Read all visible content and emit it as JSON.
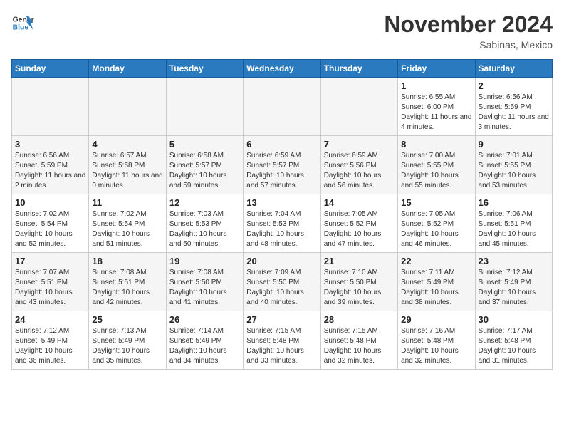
{
  "header": {
    "logo_line1": "General",
    "logo_line2": "Blue",
    "month": "November 2024",
    "location": "Sabinas, Mexico"
  },
  "weekdays": [
    "Sunday",
    "Monday",
    "Tuesday",
    "Wednesday",
    "Thursday",
    "Friday",
    "Saturday"
  ],
  "weeks": [
    [
      {
        "day": "",
        "info": ""
      },
      {
        "day": "",
        "info": ""
      },
      {
        "day": "",
        "info": ""
      },
      {
        "day": "",
        "info": ""
      },
      {
        "day": "",
        "info": ""
      },
      {
        "day": "1",
        "info": "Sunrise: 6:55 AM\nSunset: 6:00 PM\nDaylight: 11 hours and 4 minutes."
      },
      {
        "day": "2",
        "info": "Sunrise: 6:56 AM\nSunset: 5:59 PM\nDaylight: 11 hours and 3 minutes."
      }
    ],
    [
      {
        "day": "3",
        "info": "Sunrise: 6:56 AM\nSunset: 5:59 PM\nDaylight: 11 hours and 2 minutes."
      },
      {
        "day": "4",
        "info": "Sunrise: 6:57 AM\nSunset: 5:58 PM\nDaylight: 11 hours and 0 minutes."
      },
      {
        "day": "5",
        "info": "Sunrise: 6:58 AM\nSunset: 5:57 PM\nDaylight: 10 hours and 59 minutes."
      },
      {
        "day": "6",
        "info": "Sunrise: 6:59 AM\nSunset: 5:57 PM\nDaylight: 10 hours and 57 minutes."
      },
      {
        "day": "7",
        "info": "Sunrise: 6:59 AM\nSunset: 5:56 PM\nDaylight: 10 hours and 56 minutes."
      },
      {
        "day": "8",
        "info": "Sunrise: 7:00 AM\nSunset: 5:55 PM\nDaylight: 10 hours and 55 minutes."
      },
      {
        "day": "9",
        "info": "Sunrise: 7:01 AM\nSunset: 5:55 PM\nDaylight: 10 hours and 53 minutes."
      }
    ],
    [
      {
        "day": "10",
        "info": "Sunrise: 7:02 AM\nSunset: 5:54 PM\nDaylight: 10 hours and 52 minutes."
      },
      {
        "day": "11",
        "info": "Sunrise: 7:02 AM\nSunset: 5:54 PM\nDaylight: 10 hours and 51 minutes."
      },
      {
        "day": "12",
        "info": "Sunrise: 7:03 AM\nSunset: 5:53 PM\nDaylight: 10 hours and 50 minutes."
      },
      {
        "day": "13",
        "info": "Sunrise: 7:04 AM\nSunset: 5:53 PM\nDaylight: 10 hours and 48 minutes."
      },
      {
        "day": "14",
        "info": "Sunrise: 7:05 AM\nSunset: 5:52 PM\nDaylight: 10 hours and 47 minutes."
      },
      {
        "day": "15",
        "info": "Sunrise: 7:05 AM\nSunset: 5:52 PM\nDaylight: 10 hours and 46 minutes."
      },
      {
        "day": "16",
        "info": "Sunrise: 7:06 AM\nSunset: 5:51 PM\nDaylight: 10 hours and 45 minutes."
      }
    ],
    [
      {
        "day": "17",
        "info": "Sunrise: 7:07 AM\nSunset: 5:51 PM\nDaylight: 10 hours and 43 minutes."
      },
      {
        "day": "18",
        "info": "Sunrise: 7:08 AM\nSunset: 5:51 PM\nDaylight: 10 hours and 42 minutes."
      },
      {
        "day": "19",
        "info": "Sunrise: 7:08 AM\nSunset: 5:50 PM\nDaylight: 10 hours and 41 minutes."
      },
      {
        "day": "20",
        "info": "Sunrise: 7:09 AM\nSunset: 5:50 PM\nDaylight: 10 hours and 40 minutes."
      },
      {
        "day": "21",
        "info": "Sunrise: 7:10 AM\nSunset: 5:50 PM\nDaylight: 10 hours and 39 minutes."
      },
      {
        "day": "22",
        "info": "Sunrise: 7:11 AM\nSunset: 5:49 PM\nDaylight: 10 hours and 38 minutes."
      },
      {
        "day": "23",
        "info": "Sunrise: 7:12 AM\nSunset: 5:49 PM\nDaylight: 10 hours and 37 minutes."
      }
    ],
    [
      {
        "day": "24",
        "info": "Sunrise: 7:12 AM\nSunset: 5:49 PM\nDaylight: 10 hours and 36 minutes."
      },
      {
        "day": "25",
        "info": "Sunrise: 7:13 AM\nSunset: 5:49 PM\nDaylight: 10 hours and 35 minutes."
      },
      {
        "day": "26",
        "info": "Sunrise: 7:14 AM\nSunset: 5:49 PM\nDaylight: 10 hours and 34 minutes."
      },
      {
        "day": "27",
        "info": "Sunrise: 7:15 AM\nSunset: 5:48 PM\nDaylight: 10 hours and 33 minutes."
      },
      {
        "day": "28",
        "info": "Sunrise: 7:15 AM\nSunset: 5:48 PM\nDaylight: 10 hours and 32 minutes."
      },
      {
        "day": "29",
        "info": "Sunrise: 7:16 AM\nSunset: 5:48 PM\nDaylight: 10 hours and 32 minutes."
      },
      {
        "day": "30",
        "info": "Sunrise: 7:17 AM\nSunset: 5:48 PM\nDaylight: 10 hours and 31 minutes."
      }
    ]
  ]
}
